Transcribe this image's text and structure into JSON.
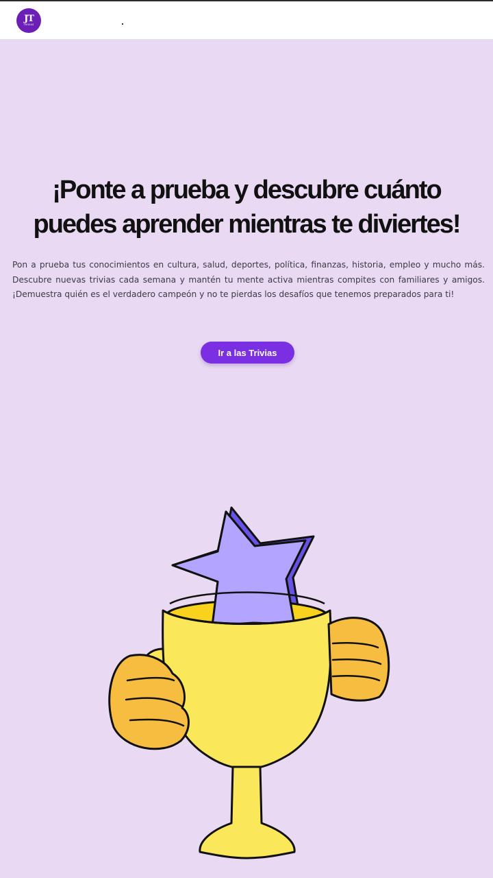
{
  "header": {
    "logo_text": "JT",
    "logo_subtext": "TRIVIAS"
  },
  "hero": {
    "title": "¡Ponte a prueba y descubre cuánto puedes aprender mientras te diviertes!",
    "description": "Pon a prueba tus conocimientos en cultura, salud, deportes, política, finanzas, historia, empleo y mucho más. Descubre nuevas trivias cada semana y mantén tu mente activa mientras compites con familiares y amigos. ¡Demuestra quién es el verdadero campeón y no te pierdas los desafíos que tenemos preparados para ti!",
    "cta_label": "Ir a las Trivias"
  },
  "illustration": {
    "icon": "trophy-with-star-icon"
  },
  "colors": {
    "background": "#e9d9f3",
    "accent": "#7b2fe2",
    "logo": "#6b1fb6",
    "trophy": "#fbe85a",
    "hands": "#f6bd41",
    "star": "#b3a4ff"
  }
}
